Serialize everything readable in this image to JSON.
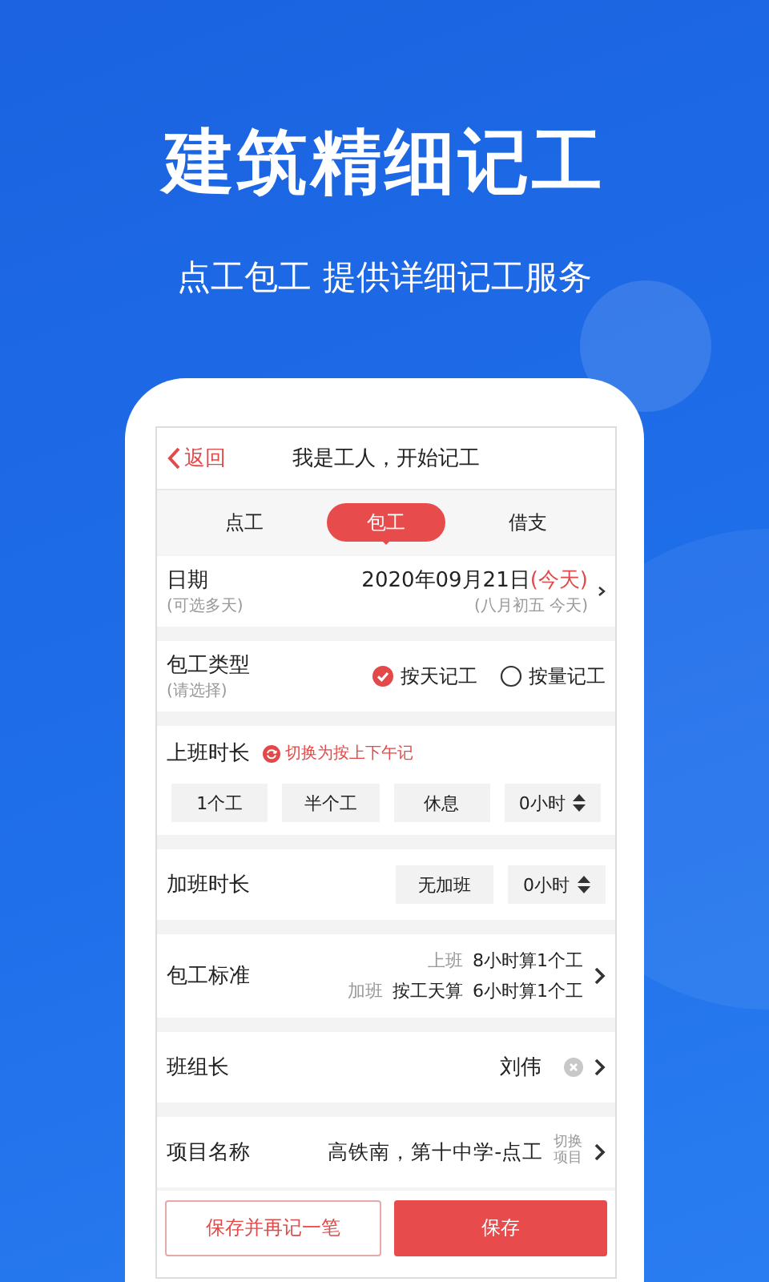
{
  "header": {
    "title": "建筑精细记工",
    "subtitle": "点工包工 提供详细记工服务"
  },
  "screen": {
    "nav": {
      "back": "返回",
      "title": "我是工人，开始记工"
    },
    "tabs": [
      {
        "label": "点工",
        "selected": false
      },
      {
        "label": "包工",
        "selected": true
      },
      {
        "label": "借支",
        "selected": false
      }
    ],
    "date": {
      "label": "日期",
      "hint": "(可选多天)",
      "value": "2020年09月21日",
      "today": "(今天)",
      "lunar": "(八月初五 今天)"
    },
    "type": {
      "label": "包工类型",
      "hint": "(请选择)",
      "options": [
        {
          "label": "按天记工",
          "selected": true
        },
        {
          "label": "按量记工",
          "selected": false
        }
      ]
    },
    "work": {
      "label": "上班时长",
      "switch": "切换为按上下午记",
      "options": [
        {
          "label": "1个工",
          "kind": "button"
        },
        {
          "label": "半个工",
          "kind": "button"
        },
        {
          "label": "休息",
          "kind": "button"
        },
        {
          "label": "0小时",
          "kind": "stepper"
        }
      ]
    },
    "overtime": {
      "label": "加班时长",
      "options": [
        {
          "label": "无加班",
          "kind": "button"
        },
        {
          "label": "0小时",
          "kind": "stepper"
        }
      ]
    },
    "standard": {
      "label": "包工标准",
      "lines": [
        {
          "tag": "上班",
          "parts": [
            "8小时算1个工"
          ]
        },
        {
          "tag": "加班",
          "parts": [
            "按工天算",
            "6小时算1个工"
          ]
        }
      ]
    },
    "leader": {
      "label": "班组长",
      "value": "刘伟"
    },
    "project": {
      "label": "项目名称",
      "value": "高铁南，第十中学-点工",
      "switch": "切换项目"
    },
    "actions": [
      {
        "label": "保存并再记一笔",
        "kind": "secondary"
      },
      {
        "label": "保存",
        "kind": "primary"
      }
    ]
  }
}
